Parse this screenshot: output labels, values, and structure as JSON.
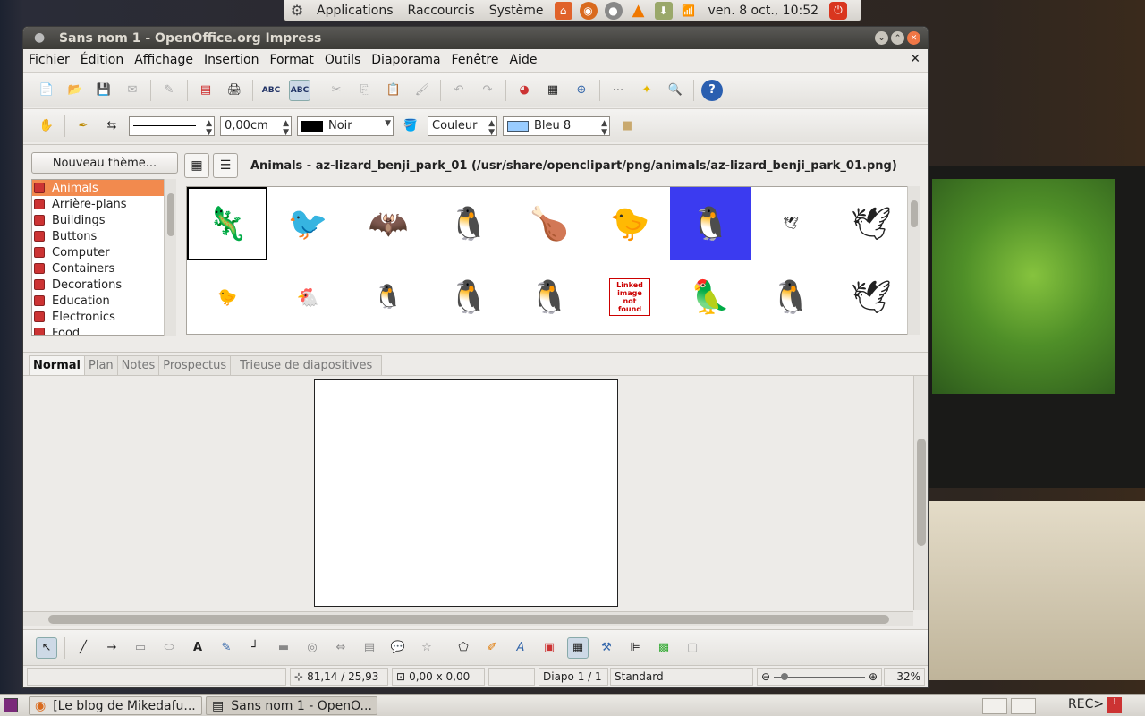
{
  "top_panel": {
    "menus": [
      "Applications",
      "Raccourcis",
      "Système"
    ],
    "clock": "ven.  8 oct., 10:52"
  },
  "window": {
    "title": "Sans nom 1 - OpenOffice.org Impress",
    "menus": [
      "Fichier",
      "Édition",
      "Affichage",
      "Insertion",
      "Format",
      "Outils",
      "Diaporama",
      "Fenêtre",
      "Aide"
    ]
  },
  "format_bar": {
    "line_width": "0,00cm",
    "line_color": "Noir",
    "area_style": "Couleur",
    "area_color": "Bleu 8",
    "line_color_hex": "#000000",
    "area_color_hex": "#99ccff"
  },
  "gallery": {
    "new_theme_label": "Nouveau thème...",
    "themes": [
      "Animals",
      "Arrière-plans",
      "Buildings",
      "Buttons",
      "Computer",
      "Containers",
      "Decorations",
      "Education",
      "Electronics",
      "Food"
    ],
    "selected_theme": "Animals",
    "header": "Animals - az-lizard_benji_park_01 (/usr/share/openclipart/png/animals/az-lizard_benji_park_01.png)",
    "thumbs_row1": [
      "🦎",
      "🐦",
      "🦇",
      "🐧",
      "🍗",
      "🐤",
      "🐧",
      "🕊",
      "🕊"
    ],
    "thumbs_row2": [
      "🐤",
      "🐔",
      "🐧",
      "🐧",
      "🐧",
      "Linked image not found",
      "🦜",
      "🐧",
      "🕊"
    ]
  },
  "view_tabs": [
    "Normal",
    "Plan",
    "Notes",
    "Prospectus",
    "Trieuse de diapositives"
  ],
  "active_tab": "Normal",
  "status": {
    "position": "81,14 / 25,93",
    "size": "0,00 x 0,00",
    "slide": "Diapo 1 / 1",
    "layout": "Standard",
    "zoom": "32%"
  },
  "taskbar": {
    "tasks": [
      "[Le blog de Mikedafu...",
      "Sans nom 1 - OpenO..."
    ],
    "rec_label": "REC>"
  }
}
